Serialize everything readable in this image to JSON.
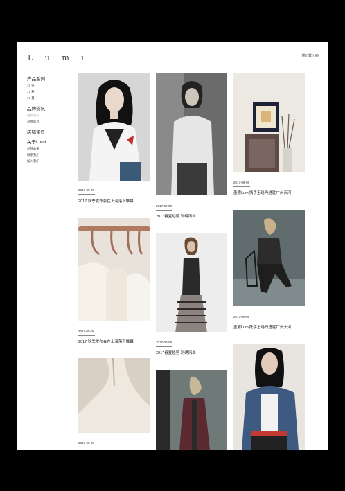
{
  "header": {
    "logo": "L u m i",
    "lang": "简 | 繁 | EN"
  },
  "nav": {
    "products": "产品系列",
    "p1": "17 冬",
    "p2": "17 秋",
    "p3": "17 夏",
    "brand": "品牌资讯",
    "b1": "最新资讯",
    "b2": "品牌影片",
    "stores": "店铺资讯",
    "about": "关于Lumi",
    "a1": "品牌故事",
    "a2": "联系我们",
    "a3": "加入我们"
  },
  "posts": [
    {
      "date": "2017-08-08",
      "title": "2017 秋季发布会在上海落下帷幕",
      "image": "model-white-shirt"
    },
    {
      "date": "2017-08-08",
      "title": "2017春夏趋势 刺绣风尚",
      "image": "man-portrait"
    },
    {
      "date": "2017-08-08",
      "title": "盖索Lumi携手王珞丹进驻广州天河",
      "image": "interior-still-life"
    },
    {
      "date": "2017-08-08",
      "title": "2017 秋季发布会在上海落下帷幕",
      "image": "hangers-rack"
    },
    {
      "date": "2017-08-08",
      "title": "2017春夏趋势 刺绣风尚",
      "image": "model-striped-pants"
    },
    {
      "date": "2017-08-08",
      "title": "盖索Lumi携手王珞丹进驻广州天河",
      "image": "model-seated-chair"
    },
    {
      "date": "2017-08-08",
      "title": "",
      "image": "hanger-closeup"
    },
    {
      "date": "",
      "title": "",
      "image": "model-long-coat"
    },
    {
      "date": "",
      "title": "",
      "image": "model-denim-jacket"
    }
  ]
}
